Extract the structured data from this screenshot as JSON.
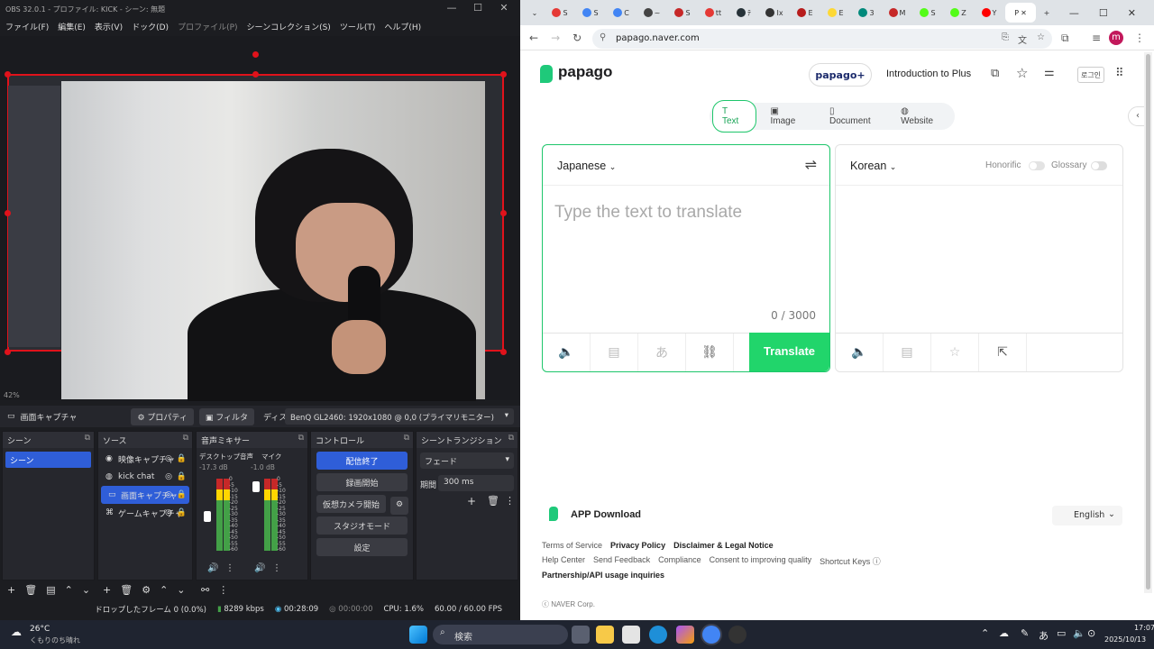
{
  "obs": {
    "title": "OBS 32.0.1 - プロファイル: KICK - シーン: 無題",
    "menu": [
      "ファイル(F)",
      "編集(E)",
      "表示(V)",
      "ドック(D)",
      "プロファイル(P)",
      "シーンコレクション(S)",
      "ツール(T)",
      "ヘルプ(H)"
    ],
    "zoom": "42%",
    "source_label": "画面キャプチャ",
    "properties_label": "プロパティ",
    "filters_label": "フィルタ",
    "display_label": "ディスプレイ",
    "display_value": "BenQ GL2460: 1920x1080 @ 0,0 (プライマリモニター)",
    "docks": {
      "scenes": {
        "title": "シーン",
        "items": [
          "シーン"
        ]
      },
      "sources": {
        "title": "ソース",
        "items": [
          {
            "label": "映像キャプチャ",
            "icon": "camera-icon"
          },
          {
            "label": "kick chat",
            "icon": "globe-icon"
          },
          {
            "label": "画面キャプチャ",
            "icon": "monitor-icon",
            "selected": true
          },
          {
            "label": "ゲームキャプチャ",
            "icon": "gamepad-icon"
          }
        ]
      },
      "mixer": {
        "title": "音声ミキサー",
        "ch1": "デスクトップ音声",
        "ch1_db": "-17.3 dB",
        "ch2": "マイク",
        "ch2_db": "-1.0 dB",
        "scale": [
          "0",
          "-5",
          "-10",
          "-15",
          "-20",
          "-25",
          "-30",
          "-35",
          "-40",
          "-45",
          "-50",
          "-55",
          "-60"
        ]
      },
      "controls": {
        "title": "コントロール",
        "buttons": [
          "配信終了",
          "録画開始",
          "仮想カメラ開始",
          "スタジオモード",
          "設定"
        ]
      },
      "transitions": {
        "title": "シーントランジション",
        "type": "フェード",
        "duration_label": "期間",
        "duration": "300 ms"
      }
    },
    "status": {
      "dropped": "ドロップしたフレーム 0 (0.0%)",
      "bitrate": "8289 kbps",
      "live_time": "00:28:09",
      "rec_time": "00:00:00",
      "cpu": "CPU: 1.6%",
      "fps": "60.00 / 60.00 FPS"
    }
  },
  "chrome": {
    "tabs": [
      "S",
      "S",
      "C",
      "~",
      "S",
      "tt",
      "ﾃ",
      "Ix",
      "E",
      "E",
      "3",
      "M",
      "S",
      "Z",
      "Y",
      "P"
    ],
    "url": "papago.naver.com",
    "avatar_letter": "m"
  },
  "papago": {
    "brand": "papago",
    "plus": "papago+",
    "intro": "Introduction to Plus",
    "login": "로그인",
    "modes": [
      "Text",
      "Image",
      "Document",
      "Website"
    ],
    "source_lang": "Japanese",
    "target_lang": "Korean",
    "placeholder": "Type the text to translate",
    "count": "0 / 3000",
    "translate": "Translate",
    "honorific": "Honorific",
    "glossary": "Glossary",
    "app_download": "APP Download",
    "language_select": "English",
    "footer_row1": [
      "Terms of Service",
      "Privacy Policy",
      "Disclaimer & Legal Notice"
    ],
    "footer_row2": [
      "Help Center",
      "Send Feedback",
      "Compliance",
      "Consent to improving quality",
      "Shortcut Keys"
    ],
    "footer_row3": [
      "Partnership/API usage inquiries"
    ],
    "copyright": "ⓒ NAVER Corp."
  },
  "taskbar": {
    "temp": "26°C",
    "weather": "くもりのち晴れ",
    "search": "検索",
    "time": "17:07",
    "date": "2025/10/13",
    "ime": "あ"
  }
}
